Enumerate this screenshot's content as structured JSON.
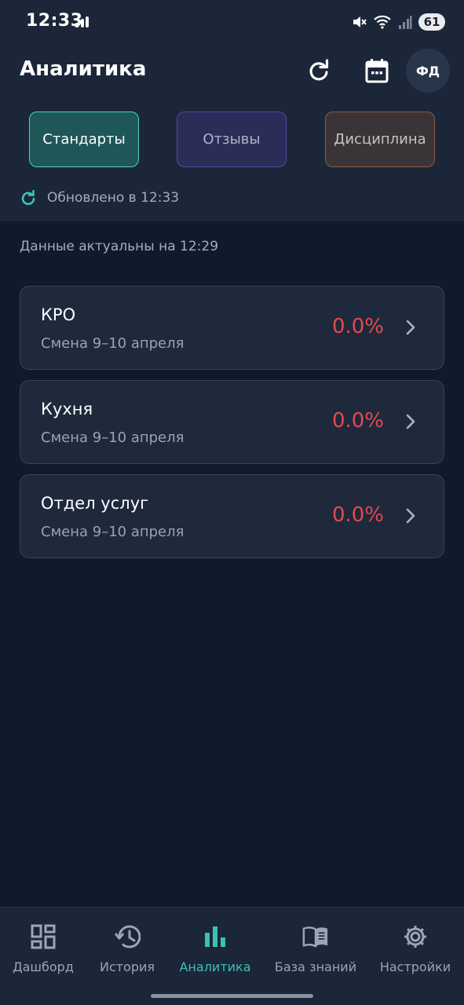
{
  "status_bar": {
    "time": "12:33",
    "battery": "61"
  },
  "header": {
    "title": "Аналитика",
    "avatar_initials": "ФД"
  },
  "tabs": [
    {
      "label": "Стандарты",
      "active": true
    },
    {
      "label": "Отзывы",
      "active": false
    },
    {
      "label": "Дисциплина",
      "active": false
    }
  ],
  "updated_text": "Обновлено в 12:33",
  "actual_text": "Данные актуальны на 12:29",
  "cards": [
    {
      "title": "КРО",
      "subtitle": "Смена 9–10 апреля",
      "value": "0.0%"
    },
    {
      "title": "Кухня",
      "subtitle": "Смена 9–10 апреля",
      "value": "0.0%"
    },
    {
      "title": "Отдел услуг",
      "subtitle": "Смена 9–10 апреля",
      "value": "0.0%"
    }
  ],
  "bottom_nav": [
    {
      "label": "Дашборд",
      "icon": "dashboard-icon",
      "active": false
    },
    {
      "label": "История",
      "icon": "history-icon",
      "active": false
    },
    {
      "label": "Аналитика",
      "icon": "bar-chart-icon",
      "active": true
    },
    {
      "label": "База знаний",
      "icon": "book-icon",
      "active": false
    },
    {
      "label": "Настройки",
      "icon": "gear-icon",
      "active": false
    }
  ],
  "colors": {
    "accent": "#3ac3b4",
    "danger": "#e5484d",
    "background": "#0f1a2c",
    "surface": "#1c2639"
  }
}
